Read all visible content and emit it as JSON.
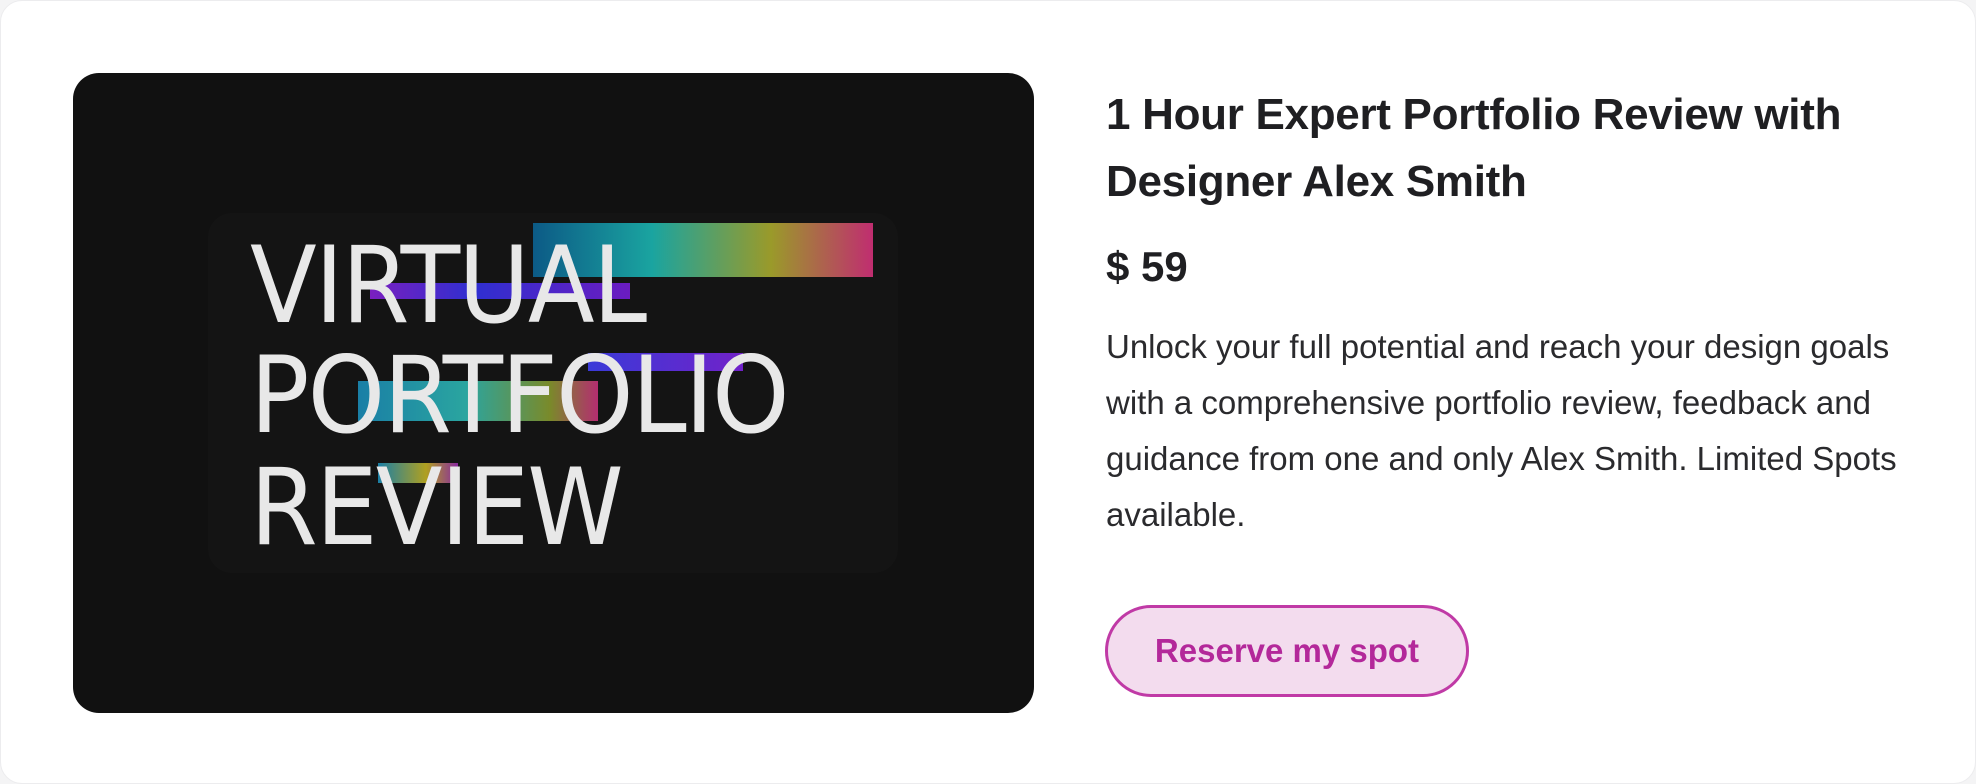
{
  "image": {
    "text_lines": [
      "VIRTUAL",
      "PORTFOLIO",
      "REVIEW"
    ]
  },
  "product": {
    "title": "1 Hour Expert Portfolio Review with Designer Alex Smith",
    "price": "$ 59",
    "description": "Unlock your full potential and reach your design goals with a comprehensive portfolio review, feedback and guidance from one and only Alex Smith. Limited Spots available.",
    "cta_label": "Reserve my spot"
  },
  "colors": {
    "accent": "#b3289a",
    "accent_border": "#c03aa6",
    "accent_background": "#f3dcee",
    "text": "#1f1f22",
    "image_background": "#111111"
  }
}
